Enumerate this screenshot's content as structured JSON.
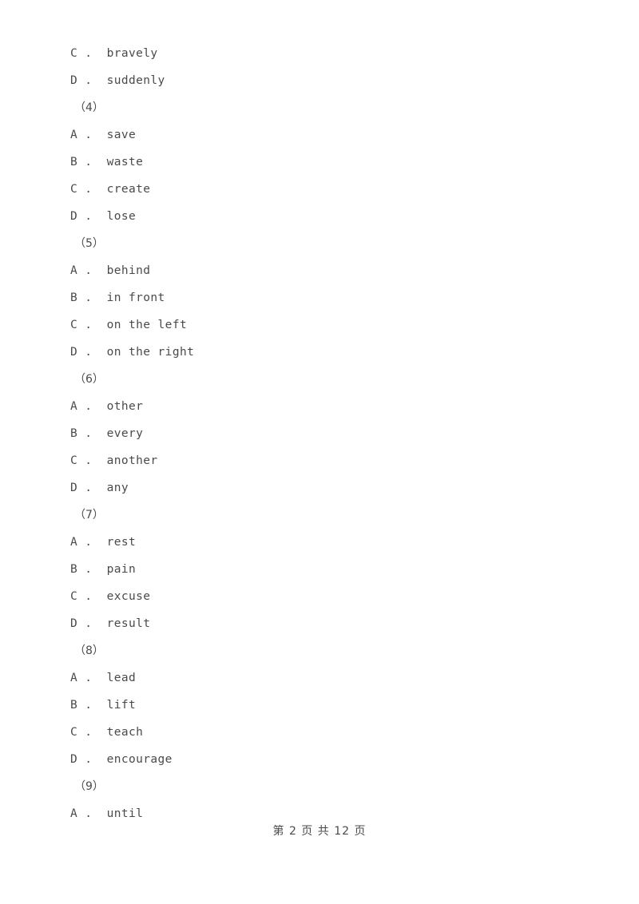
{
  "page": {
    "background_color": "#ffffff",
    "text_color": "#4a4a4a"
  },
  "blocks": [
    {
      "kind": "option",
      "letter": "C",
      "separator": " . ",
      "text": "bravely",
      "full": "C .  bravely"
    },
    {
      "kind": "option",
      "letter": "D",
      "separator": " . ",
      "text": "suddenly",
      "full": "D .  suddenly"
    },
    {
      "kind": "question",
      "label": "（4）"
    },
    {
      "kind": "option",
      "letter": "A",
      "separator": " . ",
      "text": "save",
      "full": "A .  save"
    },
    {
      "kind": "option",
      "letter": "B",
      "separator": " . ",
      "text": "waste",
      "full": "B .  waste"
    },
    {
      "kind": "option",
      "letter": "C",
      "separator": " . ",
      "text": "create",
      "full": "C .  create"
    },
    {
      "kind": "option",
      "letter": "D",
      "separator": " . ",
      "text": "lose",
      "full": "D .  lose"
    },
    {
      "kind": "question",
      "label": "（5）"
    },
    {
      "kind": "option",
      "letter": "A",
      "separator": " . ",
      "text": "behind",
      "full": "A .  behind"
    },
    {
      "kind": "option",
      "letter": "B",
      "separator": " . ",
      "text": "in front",
      "full": "B .  in front"
    },
    {
      "kind": "option",
      "letter": "C",
      "separator": " . ",
      "text": "on the left",
      "full": "C .  on the left"
    },
    {
      "kind": "option",
      "letter": "D",
      "separator": " . ",
      "text": "on the right",
      "full": "D .  on the right"
    },
    {
      "kind": "question",
      "label": "（6）"
    },
    {
      "kind": "option",
      "letter": "A",
      "separator": " . ",
      "text": "other",
      "full": "A .  other"
    },
    {
      "kind": "option",
      "letter": "B",
      "separator": " . ",
      "text": "every",
      "full": "B .  every"
    },
    {
      "kind": "option",
      "letter": "C",
      "separator": " . ",
      "text": "another",
      "full": "C .  another"
    },
    {
      "kind": "option",
      "letter": "D",
      "separator": " . ",
      "text": "any",
      "full": "D .  any"
    },
    {
      "kind": "question",
      "label": "（7）"
    },
    {
      "kind": "option",
      "letter": "A",
      "separator": " . ",
      "text": "rest",
      "full": "A .  rest"
    },
    {
      "kind": "option",
      "letter": "B",
      "separator": " . ",
      "text": "pain",
      "full": "B .  pain"
    },
    {
      "kind": "option",
      "letter": "C",
      "separator": " . ",
      "text": "excuse",
      "full": "C .  excuse"
    },
    {
      "kind": "option",
      "letter": "D",
      "separator": " . ",
      "text": "result",
      "full": "D .  result"
    },
    {
      "kind": "question",
      "label": "（8）"
    },
    {
      "kind": "option",
      "letter": "A",
      "separator": " . ",
      "text": "lead",
      "full": "A .  lead"
    },
    {
      "kind": "option",
      "letter": "B",
      "separator": " . ",
      "text": "lift",
      "full": "B .  lift"
    },
    {
      "kind": "option",
      "letter": "C",
      "separator": " . ",
      "text": "teach",
      "full": "C .  teach"
    },
    {
      "kind": "option",
      "letter": "D",
      "separator": " . ",
      "text": "encourage",
      "full": "D .  encourage"
    },
    {
      "kind": "question",
      "label": "（9）"
    },
    {
      "kind": "option",
      "letter": "A",
      "separator": " . ",
      "text": "until",
      "full": "A .  until"
    }
  ],
  "footer": {
    "text": "第 2 页 共 12 页",
    "page_number": "2",
    "total_pages": "12"
  }
}
